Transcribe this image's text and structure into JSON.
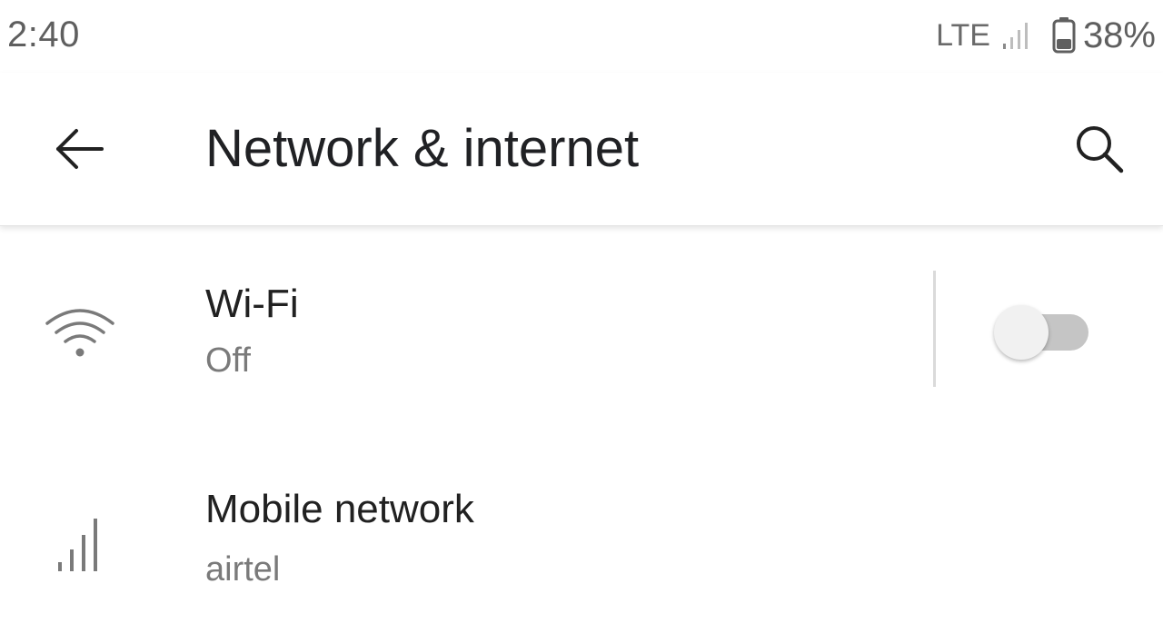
{
  "status_bar": {
    "time": "2:40",
    "network_type": "LTE",
    "battery_percent": "38%",
    "battery_level": 0.38
  },
  "app_bar": {
    "title": "Network & internet",
    "back_icon": "arrow-back-icon",
    "search_icon": "search-icon"
  },
  "items": [
    {
      "title": "Wi-Fi",
      "subtitle": "Off",
      "icon": "wifi-icon",
      "toggle_on": false
    },
    {
      "title": "Mobile network",
      "subtitle": "airtel",
      "icon": "cell-signal-icon"
    }
  ],
  "colors": {
    "text_primary": "#212121",
    "text_secondary": "#7a7a7a",
    "toggle_track_off": "#c5c5c5",
    "toggle_thumb_off": "#f1f1f1"
  }
}
